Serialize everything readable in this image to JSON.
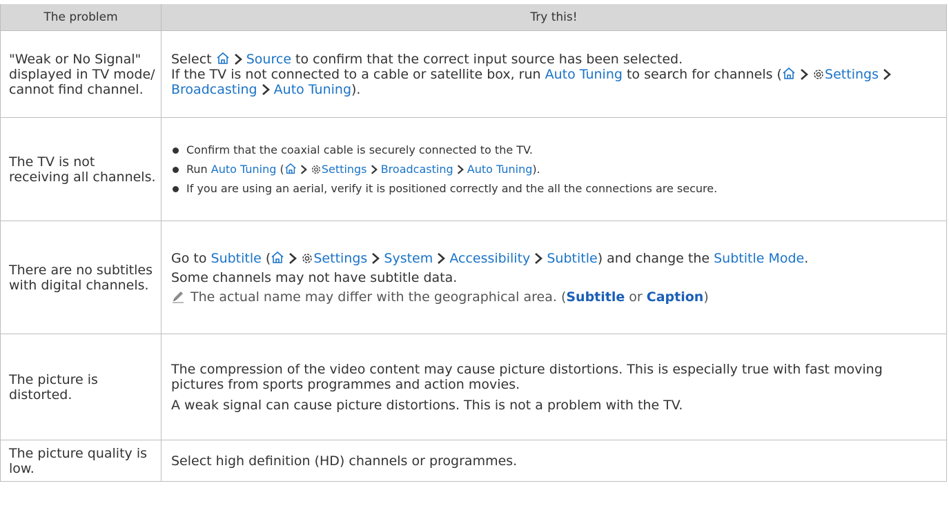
{
  "header": {
    "problem": "The problem",
    "try": "Try this!"
  },
  "icons": {
    "home": "home-icon",
    "arrow": "chevron-right-icon",
    "settings": "gear-icon",
    "note": "pencil-icon"
  },
  "colors": {
    "link": "#1a73c8",
    "header_bg": "#d7d7d7",
    "border": "#bdbdbd"
  },
  "rows": [
    {
      "problem": "\"Weak or No Signal\" displayed in TV mode/ cannot find channel.",
      "line1": {
        "a": "Select ",
        "source": "Source",
        "b": " to confirm that the correct input source has been selected."
      },
      "line2": {
        "a": "If the TV is not connected to a cable or satellite box, run ",
        "auto": "Auto Tuning",
        "b": " to search for channels (",
        "settings": "Settings",
        "broadcasting": "Broadcasting",
        "auto2": "Auto Tuning",
        "c": ")."
      }
    },
    {
      "problem": "The TV is not receiving all channels.",
      "bullets": {
        "b1": "Confirm that the coaxial cable is securely connected to the TV.",
        "b2": {
          "a": "Run ",
          "auto": "Auto Tuning",
          "b": " (",
          "settings": "Settings",
          "broadcasting": "Broadcasting",
          "auto2": "Auto Tuning",
          "c": ")."
        },
        "b3": "If you are using an aerial, verify it is positioned correctly and the all the connections are secure."
      }
    },
    {
      "problem": "There are no subtitles with digital channels.",
      "line1": {
        "a": "Go to ",
        "subtitle": "Subtitle",
        "b": " (",
        "settings": "Settings",
        "system": "System",
        "accessibility": "Accessibility",
        "subtitle2": "Subtitle",
        "c": ") and change the ",
        "mode": "Subtitle Mode",
        "d": "."
      },
      "line2": "Some channels may not have subtitle data.",
      "note": {
        "a": "The actual name may differ with the geographical area. (",
        "subtitle": "Subtitle",
        "or": " or ",
        "caption": "Caption",
        "c": ")"
      }
    },
    {
      "problem": "The picture is distorted.",
      "p1": "The compression of the video content may cause picture distortions. This is especially true with fast moving pictures from sports programmes and action movies.",
      "p2": "A weak signal can cause picture distortions. This is not a problem with the TV."
    },
    {
      "problem": "The picture quality is low.",
      "p1": "Select high definition (HD) channels or programmes."
    }
  ]
}
